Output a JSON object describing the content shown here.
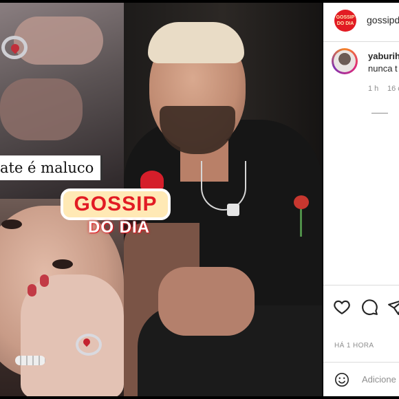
{
  "media": {
    "caption": "ate é maluco",
    "logo_top": "GOSSIP",
    "logo_bottom": "DO DIA"
  },
  "sidebar": {
    "brand_avatar_text": "GOSSIP DO DIA",
    "brand_name": "gossipdodia",
    "comment": {
      "username": "yaburih",
      "text": "nunca t",
      "time": "1 h",
      "likes": "16 c"
    },
    "post_time": "HÁ 1 HORA",
    "add_comment_placeholder": "Adicione um comentário..."
  },
  "icons": {
    "like": "heart-icon",
    "comment": "comment-icon",
    "share": "paper-plane-icon",
    "emoji": "emoji-icon"
  },
  "colors": {
    "brand_red": "#e21b23",
    "logo_cream": "#ffe9b5",
    "border": "#dbdbdb",
    "muted_text": "#8e8e8e"
  }
}
